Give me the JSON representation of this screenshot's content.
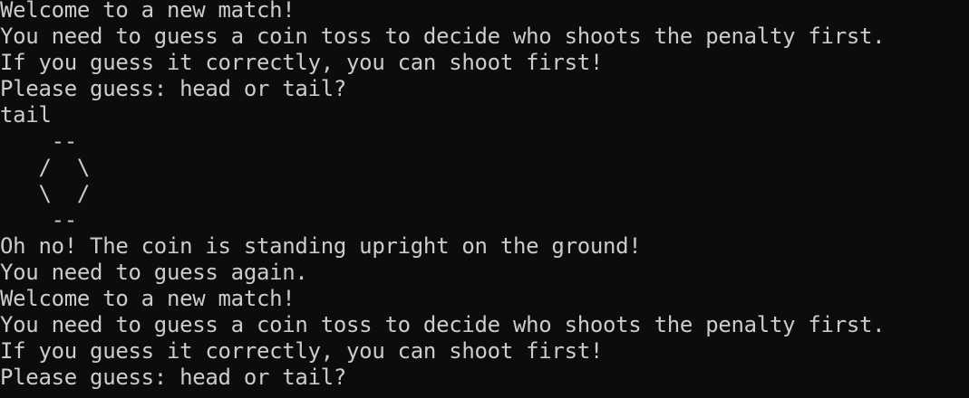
{
  "terminal": {
    "lines": [
      "Welcome to a new match!",
      "You need to guess a coin toss to decide who shoots the penalty first.",
      "If you guess it correctly, you can shoot first!",
      "Please guess: head or tail?",
      "tail",
      "    --",
      "   /  \\",
      "   \\  /",
      "    --",
      "Oh no! The coin is standing upright on the ground!",
      "You need to guess again.",
      "Welcome to a new match!",
      "You need to guess a coin toss to decide who shoots the penalty first.",
      "If you guess it correctly, you can shoot first!",
      "Please guess: head or tail?"
    ]
  },
  "colors": {
    "background": "#0c0c0c",
    "text": "#cccccc"
  }
}
